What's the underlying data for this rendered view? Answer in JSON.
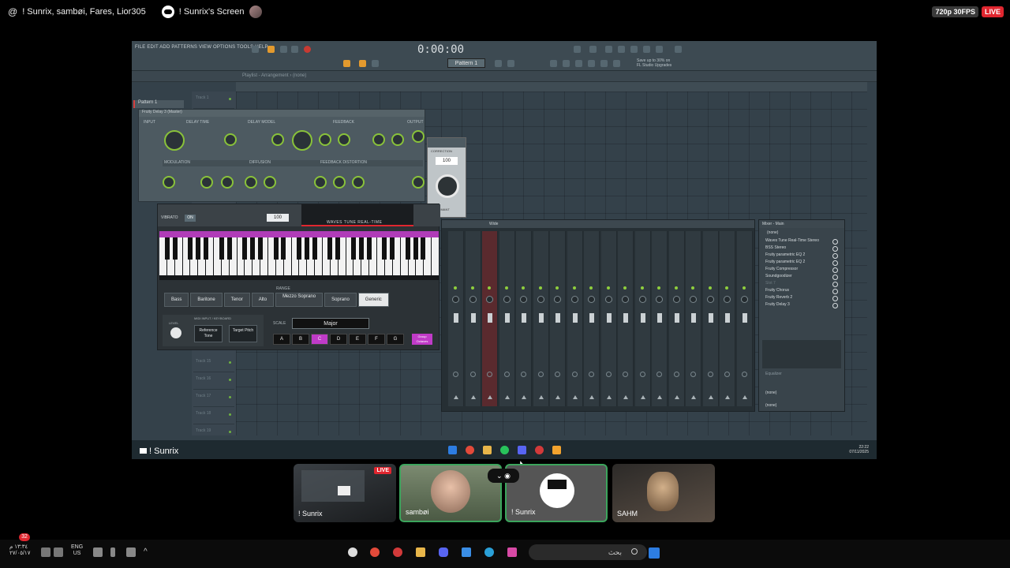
{
  "topbar": {
    "participants": "! Sunrix, sambøi, Fares, Lior305",
    "screen_title": "! Sunrix's Screen",
    "quality": "720p 30FPS",
    "live": "LIVE"
  },
  "fl": {
    "menu": "FILE  EDIT  ADD  PATTERNS  VIEW  OPTIONS  TOOLS  HELP",
    "time": "0:00:00",
    "pattern": "Pattern 1",
    "hint_line1": "Save up to 30% on",
    "hint_line2": "FL Studio Upgrades",
    "playlist_title": "Playlist - Arrangement › (none)",
    "pattern_tab": "Pattern 1",
    "tracks": [
      "Track 1",
      "Track 15",
      "Track 16",
      "Track 17",
      "Track 18",
      "Track 19"
    ]
  },
  "delay": {
    "title": "Fruity Delay 3 (Master)",
    "headers": [
      "INPUT",
      "DELAY TIME",
      "DELAY MODEL",
      "FEEDBACK",
      "OUTPUT"
    ],
    "sub_headers": [
      "MODULATION",
      "DIFFUSION",
      "FEEDBACK DISTORTION"
    ]
  },
  "waves": {
    "vibrato": "VIBRATO",
    "vibrato_on": "ON",
    "vibrato_value": "100",
    "logo": "WAVES TUNE REAL-TIME",
    "range_label": "RANGE",
    "range": [
      "Bass",
      "Baritone",
      "Tenor",
      "Alto",
      "Mezzo Soprano",
      "Soprano",
      "Generic"
    ],
    "range_selected": "Generic",
    "midi_header": "MIDI INPUT / KEYBOARD",
    "midi_level": "LEVEL",
    "reference_tone": "Reference Tone",
    "target_pitch": "Target Pitch",
    "scale_label": "SCALE",
    "scale": "Major",
    "notes": [
      "A",
      "B",
      "C",
      "D",
      "E",
      "F",
      "G"
    ],
    "note_selected": "C",
    "group_octaves": "Group Octaves"
  },
  "formant": {
    "correction": "CORRECTION",
    "value": "100",
    "formant": "FORMANT"
  },
  "mixer": {
    "title": "Wide",
    "slots_title": "Mixer - Main",
    "slots_none": "(none)",
    "slots": [
      "Waves Tune Real-Time Stereo",
      "BSS Stereo",
      "Fruity parametric EQ 2",
      "Fruity parametric EQ 2",
      "Fruity Compressor",
      "Soundgoodizer",
      "Slot 7",
      "Fruity Chorus",
      "Fruity Reverb 2",
      "Fruity Delay 3"
    ],
    "eq_label": "Equalizer"
  },
  "stream_taskbar": {
    "streamer": "! Sunrix",
    "clock_time": "22:22",
    "clock_date": "07/11/2025"
  },
  "tiles": [
    {
      "name": "! Sunrix",
      "live": "LIVE"
    },
    {
      "name": "sambøi"
    },
    {
      "name": "! Sunrix"
    },
    {
      "name": "SAHM"
    }
  ],
  "host": {
    "notif_count": "32",
    "time": "١٣:٣٤ م",
    "date": "٢٧/٠٥/١٧",
    "lang1": "ENG",
    "lang2": "US",
    "search_placeholder": "بحث"
  }
}
